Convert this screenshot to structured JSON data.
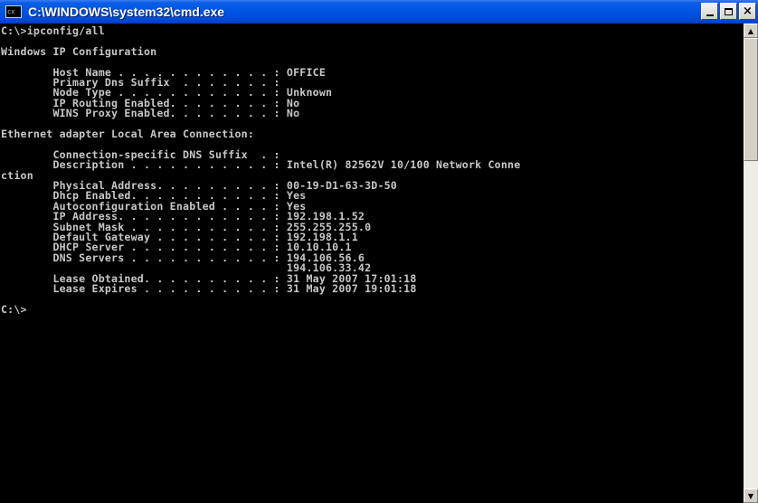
{
  "window": {
    "title": "C:\\WINDOWS\\system32\\cmd.exe",
    "icon_label": "cx",
    "icon": "cmd-icon",
    "buttons": {
      "minimize_icon": "minimize-icon",
      "maximize_icon": "maximize-icon",
      "close_icon": "close-icon",
      "close_glyph": "×"
    }
  },
  "console": {
    "lines": [
      "C:\\>ipconfig/all",
      "",
      "Windows IP Configuration",
      "",
      "        Host Name . . . . . . . . . . . . : OFFICE",
      "        Primary Dns Suffix  . . . . . . . :",
      "        Node Type . . . . . . . . . . . . : Unknown",
      "        IP Routing Enabled. . . . . . . . : No",
      "        WINS Proxy Enabled. . . . . . . . : No",
      "",
      "Ethernet adapter Local Area Connection:",
      "",
      "        Connection-specific DNS Suffix  . :",
      "        Description . . . . . . . . . . . : Intel(R) 82562V 10/100 Network Conne",
      "ction",
      "        Physical Address. . . . . . . . . : 00-19-D1-63-3D-50",
      "        Dhcp Enabled. . . . . . . . . . . : Yes",
      "        Autoconfiguration Enabled . . . . : Yes",
      "        IP Address. . . . . . . . . . . . : 192.198.1.52",
      "        Subnet Mask . . . . . . . . . . . : 255.255.255.0",
      "        Default Gateway . . . . . . . . . : 192.198.1.1",
      "        DHCP Server . . . . . . . . . . . : 10.10.10.1",
      "        DNS Servers . . . . . . . . . . . : 194.106.56.6",
      "                                            194.106.33.42",
      "        Lease Obtained. . . . . . . . . . : 31 May 2007 17:01:18",
      "        Lease Expires . . . . . . . . . . : 31 May 2007 19:01:18",
      "",
      "C:\\>"
    ],
    "colors": {
      "background": "#000000",
      "text": "#c8c8c8"
    }
  },
  "scrollbar": {
    "up_arrow": "▲",
    "down_arrow": "▼",
    "up_icon": "arrow-up-icon",
    "down_icon": "arrow-down-icon"
  }
}
